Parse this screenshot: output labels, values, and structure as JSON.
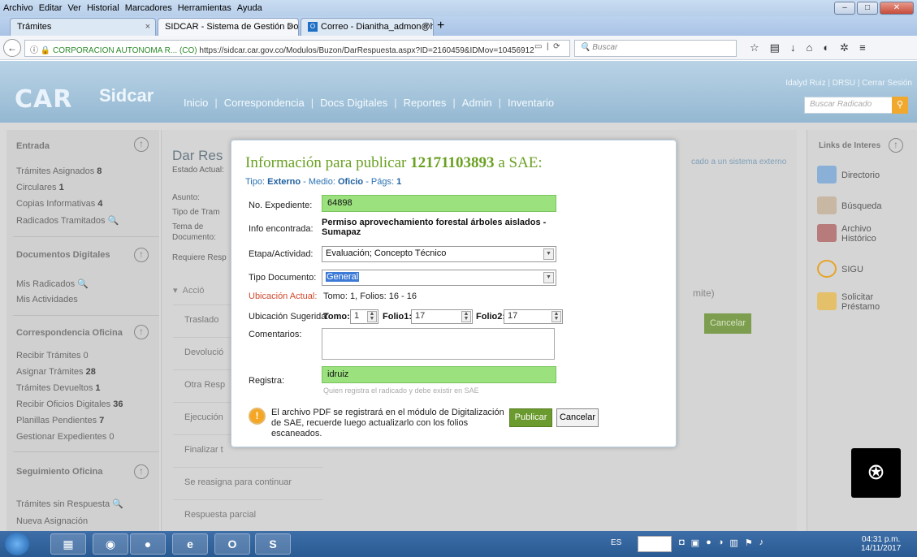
{
  "menu": [
    "Archivo",
    "Editar",
    "Ver",
    "Historial",
    "Marcadores",
    "Herramientas",
    "Ayuda"
  ],
  "tabs": [
    {
      "label": "Trámites"
    },
    {
      "label": "SIDCAR - Sistema de Gestión Doc"
    },
    {
      "label": "Correo - Dianitha_admon@h"
    }
  ],
  "url": {
    "org": "CORPORACION AUTONOMA R... (CO)",
    "address": "https://sidcar.car.gov.co/Modulos/Buzon/DarRespuesta.aspx?ID=2160459&IDMov=10456912",
    "search_placeholder": "Buscar"
  },
  "header": {
    "logo_car": "CAR",
    "logo_sidcar": "Sidcar",
    "nav": [
      "Inicio",
      "Correspondencia",
      "Docs Digitales",
      "Reportes",
      "Admin",
      "Inventario"
    ],
    "user": "Idalyd Ruiz  |  DRSU  |  Cerrar Sesión",
    "search_placeholder": "Buscar Radicado"
  },
  "sidebar": {
    "entrada": "Entrada",
    "entrada_items": [
      "Trámites Asignados",
      "Circulares",
      "Copias Informativas",
      "Radicados Tramitados"
    ],
    "entrada_counts": [
      "8",
      "1",
      "4",
      ""
    ],
    "docs": "Documentos Digitales",
    "docs_items": [
      "Mis Radicados",
      "Mis Actividades"
    ],
    "corr": "Correspondencia Oficina",
    "corr_items": [
      "Recibir Trámites 0",
      "Asignar Trámites",
      "Trámites Devueltos",
      "Recibir Oficios Digitales",
      "Planillas Pendientes",
      "Gestionar Expedientes 0"
    ],
    "corr_counts": [
      "",
      "28",
      "1",
      "36",
      "7",
      ""
    ],
    "seg": "Seguimiento Oficina",
    "seg_items": [
      "Trámites sin Respuesta",
      "Nueva Asignación"
    ]
  },
  "content": {
    "title": "Dar Res",
    "estado": "Estado Actual:",
    "asunto": "Asunto:",
    "tipo_tram": "Tipo de Tram",
    "tema": "Tema de",
    "documento": "Documento:",
    "requiere": "Requiere Resp",
    "accion": "Acció",
    "rows": [
      "Traslado",
      "Devolució",
      "Otra Resp",
      "Ejecución",
      "Finalizar t",
      "Se reasigna para continuar",
      "Respuesta parcial"
    ],
    "ext_link": "cado a un sistema externo",
    "mite": "mite)",
    "cancel": "Cancelar"
  },
  "rightbar": {
    "title": "Links de Interes",
    "items": [
      "Directorio",
      "Búsqueda",
      "Archivo Histórico",
      "SIGU",
      "Solicitar Préstamo"
    ]
  },
  "modal": {
    "title_prefix": "Información para publicar",
    "radicado": "12171103893",
    "title_suffix": "a SAE:",
    "tipo_label": "Tipo:",
    "tipo": "Externo",
    "medio_label": "- Medio:",
    "medio": "Oficio",
    "pags_label": "- Págs:",
    "pags": "1",
    "expediente_label": "No. Expediente:",
    "expediente": "64898",
    "info_label": "Info encontrada:",
    "info": "Permiso aprovechamiento forestal árboles aislados - Sumapaz",
    "etapa_label": "Etapa/Actividad:",
    "etapa": "Evaluación; Concepto Técnico",
    "tipodoc_label": "Tipo Documento:",
    "tipodoc": "General",
    "ubic_actual_label": "Ubicación Actual:",
    "ubic_actual": "Tomo: 1, Folios: 16 - 16",
    "ubic_sug_label": "Ubicación Sugerida:",
    "tomo_label": "Tomo:",
    "tomo": "1",
    "folio1_label": "Folio1:",
    "folio1": "17",
    "folio2_label": "Folio2:",
    "folio2": "17",
    "comentarios_label": "Comentarios:",
    "registra_label": "Registra:",
    "registra": "idruiz",
    "hint": "Quien registra el radicado y debe existir en SAE",
    "warning": "El archivo PDF se registrará en el módulo de Digitalización de SAE, recuerde luego actualizarlo con los folios escaneados.",
    "publish": "Publicar",
    "cancel": "Cancelar"
  },
  "taskbar": {
    "lang": "ES",
    "time": "04:31 p.m.",
    "date": "14/11/2017"
  },
  "colors": {
    "accent_green": "#6aa022",
    "link_blue": "#2a72b3",
    "input_green": "#9be27f",
    "warning_red": "#d3462c"
  }
}
